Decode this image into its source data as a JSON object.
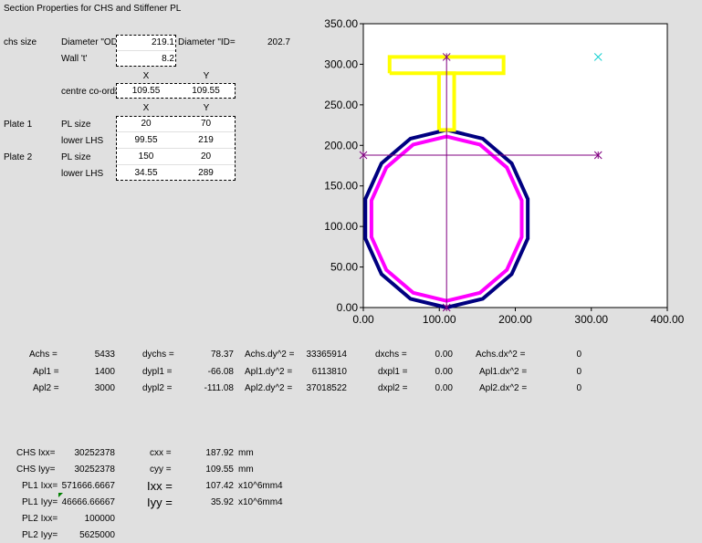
{
  "title": "Section Properties for CHS and Stiffener PL",
  "inputs": {
    "chs_size_label": "chs size",
    "diameter_od_label": "Diameter \"OD\"",
    "diameter_od_value": "219.1",
    "diameter_id_label": "Diameter \"ID=",
    "diameter_id_value": "202.7",
    "wall_label": "Wall 't'",
    "wall_value": "8.2",
    "x_header": "X",
    "y_header": "Y",
    "centre_label": "centre co-ords",
    "centre_x": "109.55",
    "centre_y": "109.55",
    "plate1_label": "Plate 1",
    "plate2_label": "Plate 2",
    "pl_size_label": "PL size",
    "lower_lhs_label": "lower LHS",
    "plate1_size_x": "20",
    "plate1_size_y": "70",
    "plate1_lhs_x": "99.55",
    "plate1_lhs_y": "219",
    "plate2_size_x": "150",
    "plate2_size_y": "20",
    "plate2_lhs_x": "34.55",
    "plate2_lhs_y": "289"
  },
  "calc_rows": [
    {
      "a_label": "Achs =",
      "a_val": "5433",
      "dy_label": "dychs =",
      "dy_val": "78.37",
      "ady_label": "Achs.dy^2 =",
      "ady_val": "33365914",
      "dx_label": "dxchs =",
      "dx_val": "0.00",
      "adx_label": "Achs.dx^2 =",
      "adx_val": "0"
    },
    {
      "a_label": "Apl1 =",
      "a_val": "1400",
      "dy_label": "dypl1 =",
      "dy_val": "-66.08",
      "ady_label": "Apl1.dy^2 =",
      "ady_val": "6113810",
      "dx_label": "dxpl1 =",
      "dx_val": "0.00",
      "adx_label": "Apl1.dx^2 =",
      "adx_val": "0"
    },
    {
      "a_label": "Apl2 =",
      "a_val": "3000",
      "dy_label": "dypl2 =",
      "dy_val": "-111.08",
      "ady_label": "Apl2.dy^2 =",
      "ady_val": "37018522",
      "dx_label": "dxpl2 =",
      "dx_val": "0.00",
      "adx_label": "Apl2.dx^2 =",
      "adx_val": "0"
    }
  ],
  "inertia": [
    {
      "label": "CHS  Ixx=",
      "value": "30252378"
    },
    {
      "label": "CHS  Iyy=",
      "value": "30252378"
    },
    {
      "label": "PL1 Ixx=",
      "value": "571666.6667"
    },
    {
      "label": "PL1 Iyy=",
      "value": "46666.66667"
    },
    {
      "label": "PL2 Ixx=",
      "value": "100000"
    },
    {
      "label": "PL2 Iyy=",
      "value": "5625000"
    }
  ],
  "results": {
    "cxx_label": "cxx =",
    "cxx_val": "187.92",
    "cxx_unit": "mm",
    "cyy_label": "cyy =",
    "cyy_val": "109.55",
    "cyy_unit": "mm",
    "ixx_label": "Ixx =",
    "ixx_val": "107.42",
    "ixx_unit": "x10^6mm4",
    "iyy_label": "Iyy =",
    "iyy_val": "35.92",
    "iyy_unit": "x10^6mm4"
  },
  "colors": {
    "chs_outer": "#000080",
    "chs_inner": "#ff00ff",
    "plate": "#ffff00",
    "axis_line": "#800080",
    "marker": "#00cccc"
  },
  "chart_data": {
    "type": "scatter",
    "xlim": [
      0,
      400
    ],
    "ylim": [
      0,
      350
    ],
    "x_ticks": [
      "0.00",
      "100.00",
      "200.00",
      "300.00",
      "400.00"
    ],
    "y_ticks": [
      "0.00",
      "50.00",
      "100.00",
      "150.00",
      "200.00",
      "250.00",
      "300.00",
      "350.00"
    ],
    "grid": false,
    "series": [
      {
        "style": "chs_outer",
        "points": [
          [
            109.55,
            0
          ],
          [
            157.1,
            10.8
          ],
          [
            195.2,
            41.2
          ],
          [
            216.4,
            85.2
          ],
          [
            216.4,
            133.9
          ],
          [
            195.2,
            177.9
          ],
          [
            157.1,
            208.3
          ],
          [
            109.55,
            219.1
          ],
          [
            62,
            208.3
          ],
          [
            23.9,
            177.9
          ],
          [
            2.7,
            133.9
          ],
          [
            2.7,
            85.2
          ],
          [
            23.9,
            41.2
          ],
          [
            62,
            10.8
          ],
          [
            109.55,
            0
          ]
        ]
      },
      {
        "style": "chs_inner",
        "points": [
          [
            109.55,
            8.2
          ],
          [
            153.5,
            18.2
          ],
          [
            188.8,
            46.4
          ],
          [
            208.4,
            87
          ],
          [
            208.4,
            132.1
          ],
          [
            188.8,
            172.7
          ],
          [
            153.5,
            200.9
          ],
          [
            109.55,
            210.9
          ],
          [
            65.6,
            200.9
          ],
          [
            30.3,
            172.7
          ],
          [
            10.7,
            132.1
          ],
          [
            10.7,
            87
          ],
          [
            30.3,
            46.4
          ],
          [
            65.6,
            18.2
          ],
          [
            109.55,
            8.2
          ]
        ]
      },
      {
        "style": "plate",
        "points": [
          [
            99.55,
            219
          ],
          [
            119.55,
            219
          ],
          [
            119.55,
            289
          ],
          [
            99.55,
            289
          ],
          [
            99.55,
            219
          ]
        ]
      },
      {
        "style": "plate",
        "points": [
          [
            34.55,
            289
          ],
          [
            184.55,
            289
          ],
          [
            184.55,
            309
          ],
          [
            34.55,
            309
          ],
          [
            34.55,
            289
          ]
        ]
      },
      {
        "style": "axis_line",
        "points": [
          [
            109.55,
            0
          ],
          [
            109.55,
            309
          ]
        ]
      },
      {
        "style": "axis_line",
        "points": [
          [
            0,
            187.92
          ],
          [
            309,
            187.92
          ]
        ]
      },
      {
        "style": "marker",
        "points": [
          [
            309,
            309
          ]
        ]
      }
    ],
    "markers": [
      [
        109.55,
        0
      ],
      [
        109.55,
        309
      ],
      [
        0,
        187.92
      ],
      [
        309,
        187.92
      ]
    ]
  }
}
